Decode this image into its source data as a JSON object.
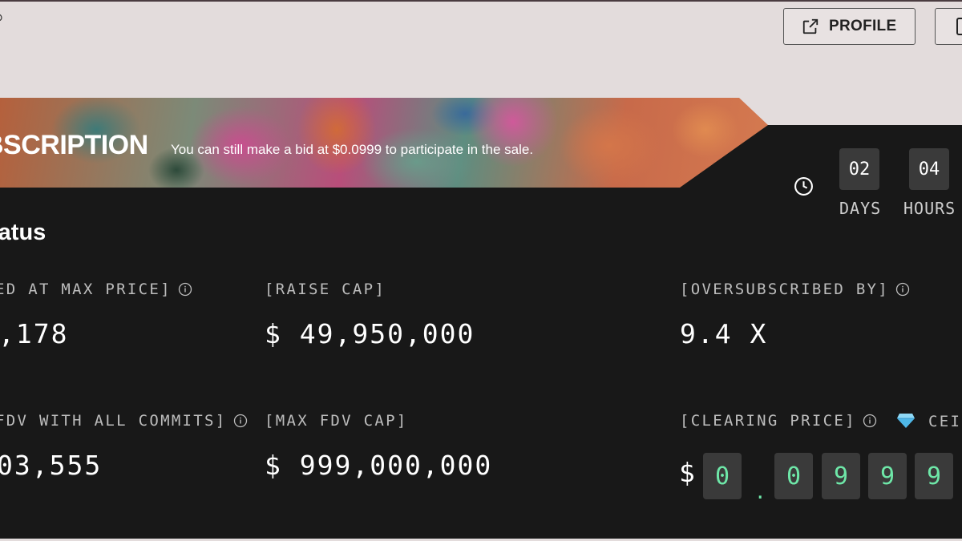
{
  "header": {
    "profile_label": "PROFILE"
  },
  "banner": {
    "title": "BSCRIPTION",
    "subtitle": "You can still make a bid at $0.0999 to participate in the sale."
  },
  "countdown": {
    "days_value": "02",
    "days_label": "DAYS",
    "hours_value": "04",
    "hours_label": "HOURS"
  },
  "status": {
    "title": "tatus",
    "stats": {
      "committed_label": "ED AT MAX PRICE]",
      "committed_value": ",178",
      "raise_cap_label": "[RAISE CAP]",
      "raise_cap_value": "$ 49,950,000",
      "oversubscribed_label": "[OVERSUBSCRIBED BY]",
      "oversubscribed_value": "9.4 X",
      "fdv_label": "FDV WITH ALL COMMITS]",
      "fdv_value": "03,555",
      "max_fdv_label": "[MAX FDV CAP]",
      "max_fdv_value": "$ 999,000,000",
      "clearing_label": "[CLEARING PRICE]",
      "ceil_label": "CEI"
    },
    "clearing_price": {
      "currency": "$",
      "digits": [
        "0",
        "0",
        "9",
        "9",
        "9"
      ],
      "separator": "."
    }
  },
  "colors": {
    "background_light": "#e3dcdc",
    "panel_dark": "#181818",
    "digit_green": "#6ee7a8",
    "box_gray": "#3a3a3a",
    "gem_blue": "#4fb8e8"
  }
}
